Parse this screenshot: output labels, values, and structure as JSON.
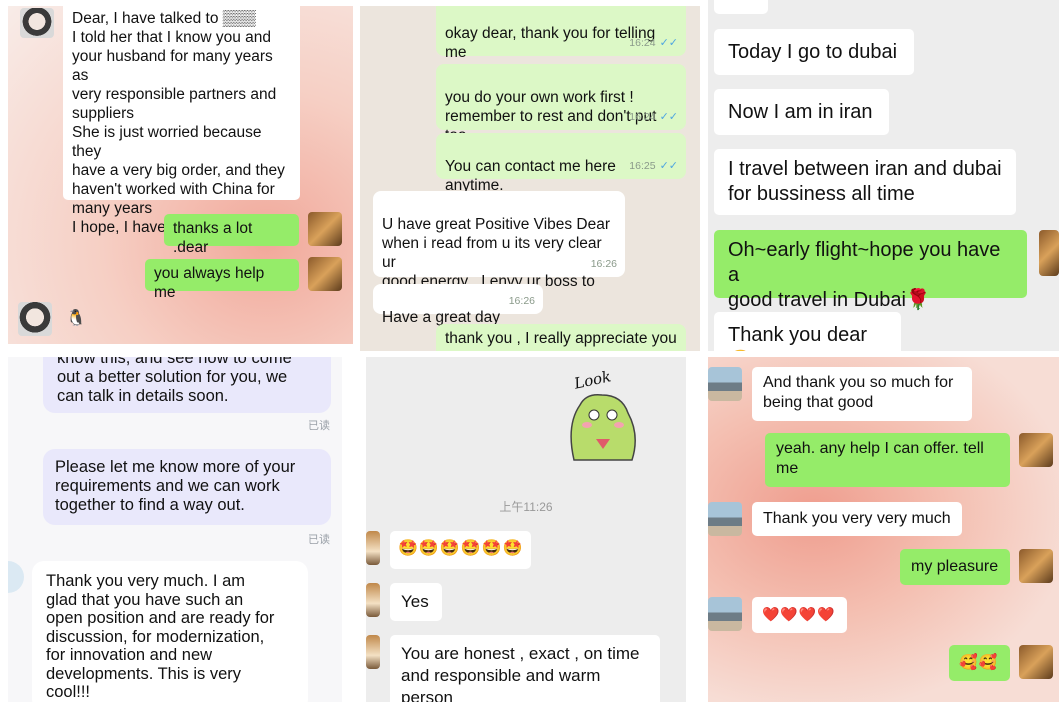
{
  "panel1": {
    "msg_incoming": "Dear, I have talked to ▒▒▒\nI told her that I know you and\nyour husband for many years as\nvery responsible partners and\nsuppliers\nShe is just worried because they\nhave a very big order, and they\nhaven't worked with China for\nmany years\nI hope, I have done my best",
    "msg_out1": "thanks a lot .dear",
    "msg_out2": "you always help me",
    "sticker_icon": "penguin-icon"
  },
  "panel2": {
    "msg1": "okay dear, thank you for telling me\nso much. I also inderstand that you\nare busy",
    "msg1_time": "16:24",
    "msg2": "you do your own work first !\nremember to rest and don't put too\nmuch presure in yourself.",
    "msg2_time": "16:24",
    "msg3": "You can contact me here anytime.",
    "msg3_time": "16:25",
    "msg4": "U have great Positive Vibes Dear\nwhen i read from u its very clear ur\ngood energy , I envy ur boss to\nhave u",
    "msg4_time": "16:26",
    "msg5": "Have a great day",
    "msg5_time": "16:26",
    "msg6": "thank you , I really appreciate you",
    "tick_glyph": "✓✓"
  },
  "panel3": {
    "msg1": "Today I go to dubai",
    "msg2": "Now I am in iran",
    "msg3": "I travel between iran and dubai\nfor bussiness all time",
    "msg4": "Oh~early flight~hope you have a\ngood travel in Dubai🌹",
    "msg5": "Thank you dear 😁"
  },
  "panel4": {
    "msg1": "know this, and see how to come\nout a better solution for you, we\ncan talk in details soon.",
    "read1": "已读",
    "msg2": "Please let me know more of your\nrequirements and we can work\ntogether to find a way out.",
    "read2": "已读",
    "msg3": "Thank you very much.  I am\nglad that you have such an\nopen position and are ready for\ndiscussion, for modernization,\nfor innovation and new\ndevelopments.  This is very\ncool!!!"
  },
  "panel5": {
    "sticker_text": "Look",
    "timestamp": "上午11:26",
    "emojis": "🤩🤩🤩🤩🤩🤩",
    "msg_yes": "Yes",
    "msg_last": "You are honest , exact , on time\nand responsible and warm\nperson"
  },
  "panel6": {
    "msg1": "And thank you so much for\nbeing that good",
    "msg2": "yeah.  any help I can offer.  tell\nme",
    "msg3": "Thank you very very much",
    "msg4": "my pleasure",
    "hearts": "❤️❤️❤️❤️",
    "smiles": "🥰🥰"
  }
}
